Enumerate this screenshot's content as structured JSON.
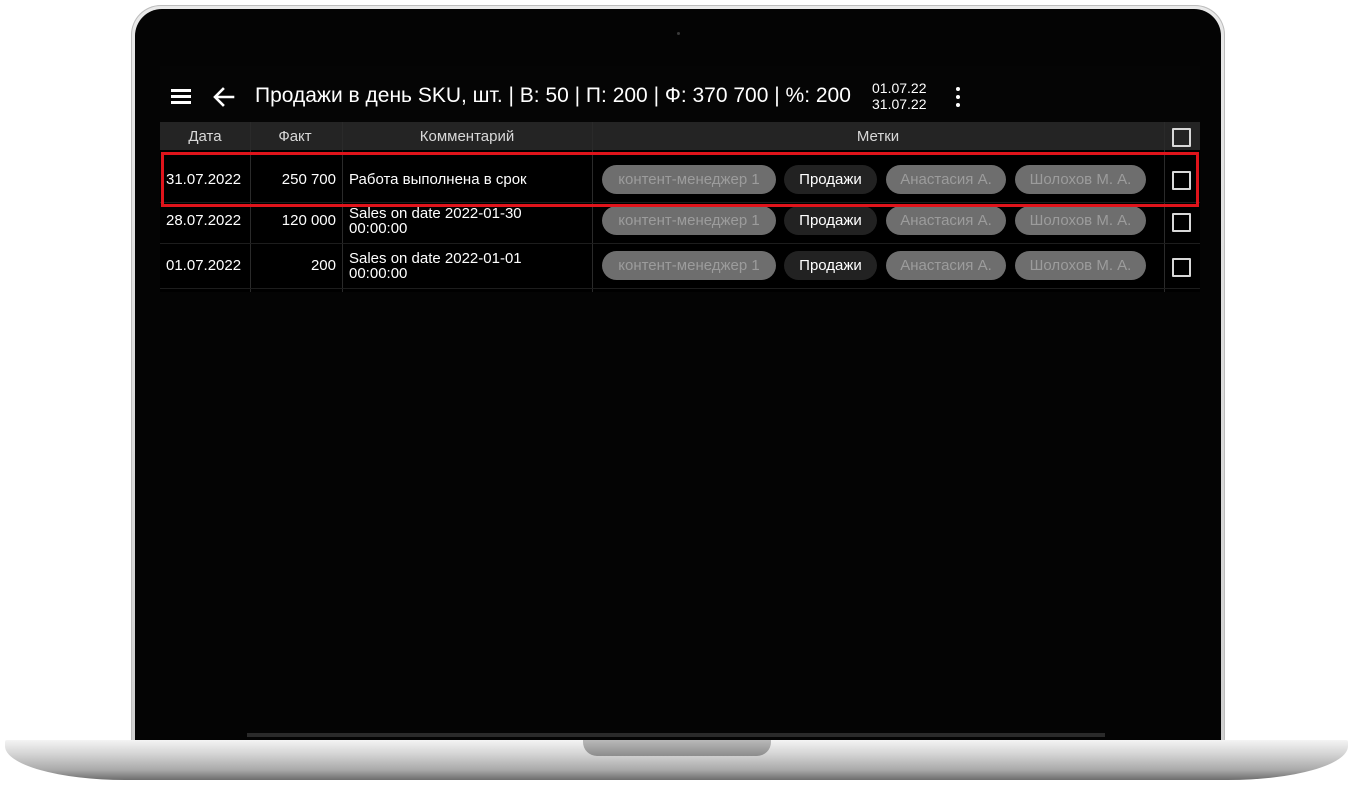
{
  "appbar": {
    "title": "Продажи в день SKU, шт. | В: 50 | П: 200 | Ф: 370 700 | %: 200",
    "date_from": "01.07.22",
    "date_to": "31.07.22"
  },
  "table": {
    "headers": {
      "date": "Дата",
      "fact": "Факт",
      "comment": "Комментарий",
      "tags": "Метки"
    },
    "rows": [
      {
        "date": "31.07.2022",
        "fact": "250 700",
        "comment_line1": "Работа выполнена в срок",
        "comment_line2": "",
        "tags": [
          "контент-менеджер 1",
          "Продажи",
          "Анастасия А.",
          "Шолохов М. А."
        ],
        "checked": false,
        "highlighted": true
      },
      {
        "date": "28.07.2022",
        "fact": "120 000",
        "comment_line1": "Sales on date 2022-01-30",
        "comment_line2": "00:00:00",
        "tags": [
          "контент-менеджер 1",
          "Продажи",
          "Анастасия А.",
          "Шолохов М. А."
        ],
        "checked": false,
        "highlighted": false
      },
      {
        "date": "01.07.2022",
        "fact": "200",
        "comment_line1": "Sales on date 2022-01-01",
        "comment_line2": "00:00:00",
        "tags": [
          "контент-менеджер 1",
          "Продажи",
          "Анастасия А.",
          "Шолохов М. А."
        ],
        "checked": false,
        "highlighted": false
      }
    ]
  },
  "colors": {
    "highlight_border": "#e0141b",
    "chip_active_bg": "#222222",
    "chip_inactive_bg": "#6e6e6e",
    "background": "#000000"
  },
  "icons": [
    "menu-icon",
    "arrow-left-icon",
    "more-vertical-icon",
    "checkbox-icon"
  ]
}
